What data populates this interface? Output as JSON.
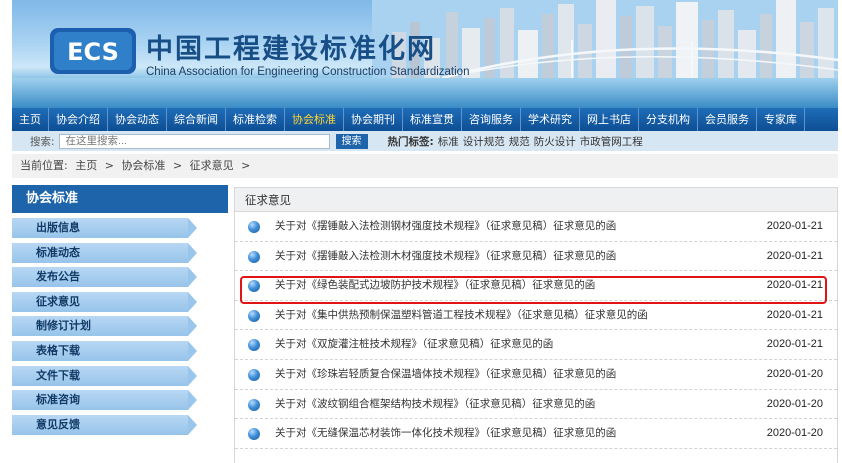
{
  "header": {
    "logo_text": "ECS",
    "title_cn": "中国工程建设标准化网",
    "title_en": "China Association for Engineering Construction Standardization"
  },
  "nav": {
    "items": [
      {
        "label": "主页",
        "active": false
      },
      {
        "label": "协会介绍",
        "active": false
      },
      {
        "label": "协会动态",
        "active": false
      },
      {
        "label": "综合新闻",
        "active": false
      },
      {
        "label": "标准检索",
        "active": false
      },
      {
        "label": "协会标准",
        "active": true
      },
      {
        "label": "协会期刊",
        "active": false
      },
      {
        "label": "标准宣贯",
        "active": false
      },
      {
        "label": "咨询服务",
        "active": false
      },
      {
        "label": "学术研究",
        "active": false
      },
      {
        "label": "网上书店",
        "active": false
      },
      {
        "label": "分支机构",
        "active": false
      },
      {
        "label": "会员服务",
        "active": false
      },
      {
        "label": "专家库",
        "active": false
      }
    ]
  },
  "search": {
    "label": "搜索:",
    "placeholder": "在这里搜索...",
    "button": "搜索",
    "hot_label": "热门标签:",
    "hot_tags": [
      "标准",
      "设计规范",
      "规范",
      "防火设计",
      "市政管网工程"
    ]
  },
  "breadcrumb": {
    "prefix": "当前位置:",
    "items": [
      "主页",
      ">",
      "协会标准",
      ">",
      "征求意见",
      ">"
    ]
  },
  "sidebar": {
    "title": "协会标准",
    "items": [
      "出版信息",
      "标准动态",
      "发布公告",
      "征求意见",
      "制修订计划",
      "表格下载",
      "文件下载",
      "标准咨询",
      "意见反馈"
    ]
  },
  "main": {
    "section_title": "征求意见",
    "rows": [
      {
        "title": "关于对《摆锤敲入法检测钢材强度技术规程》（征求意见稿）征求意见的函",
        "date": "2020-01-21"
      },
      {
        "title": "关于对《摆锤敲入法检测木材强度技术规程》（征求意见稿）征求意见的函",
        "date": "2020-01-21"
      },
      {
        "title": "关于对《绿色装配式边坡防护技术规程》（征求意见稿）征求意见的函",
        "date": "2020-01-21"
      },
      {
        "title": "关于对《集中供热预制保温塑料管道工程技术规程》（征求意见稿）征求意见的函",
        "date": "2020-01-21"
      },
      {
        "title": "关于对《双旋灌注桩技术规程》（征求意见稿）征求意见的函",
        "date": "2020-01-21"
      },
      {
        "title": "关于对《珍珠岩轻质复合保温墙体技术规程》（征求意见稿）征求意见的函",
        "date": "2020-01-20"
      },
      {
        "title": "关于对《波纹钢组合框架结构技术规程》（征求意见稿）征求意见的函",
        "date": "2020-01-20"
      },
      {
        "title": "关于对《无缝保温芯材装饰一体化技术规程》（征求意见稿）征求意见的函",
        "date": "2020-01-20"
      }
    ],
    "highlight_color": "#e01414"
  }
}
